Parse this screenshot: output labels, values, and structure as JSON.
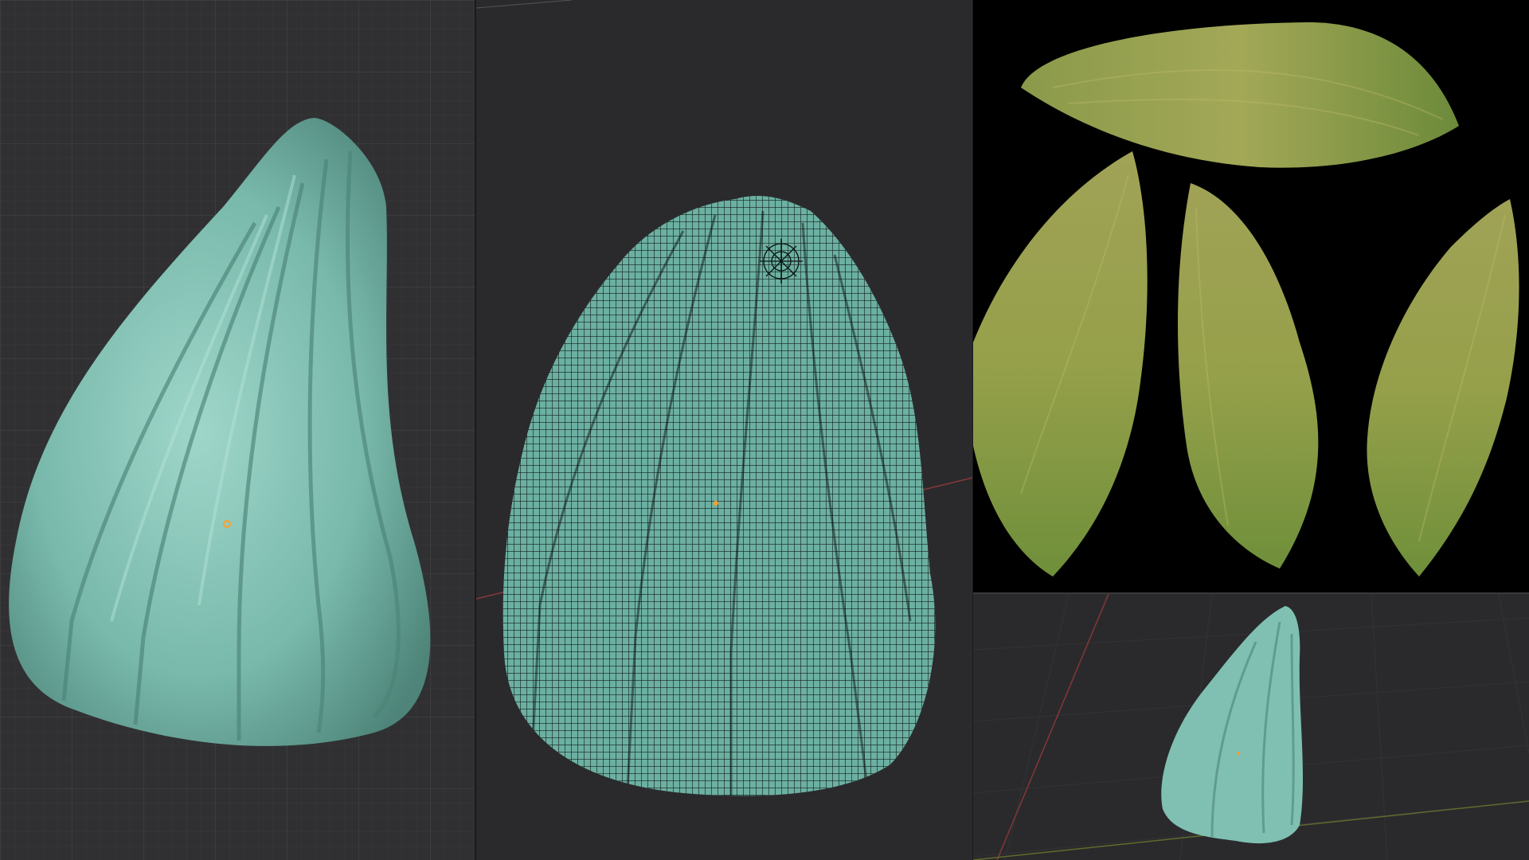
{
  "colors": {
    "viewport_bg": "#303032",
    "grid_line": "#3c3c3f",
    "sculpt_teal": "#7fc0b2",
    "wire_dark": "#0f1a18",
    "uv_bg": "#000000",
    "texture_green": "#8e9a3e",
    "axis_red": "#b04040",
    "origin_orange": "#ff9e2c"
  },
  "panels": [
    {
      "name": "sculpt-viewport",
      "content": "smooth-shaded-sculpt"
    },
    {
      "name": "wireframe-viewport",
      "content": "mesh-wireframe"
    },
    {
      "name": "texture-uv-view",
      "content": "petal-textures"
    },
    {
      "name": "perspective-viewport",
      "content": "sculpt-preview"
    }
  ]
}
